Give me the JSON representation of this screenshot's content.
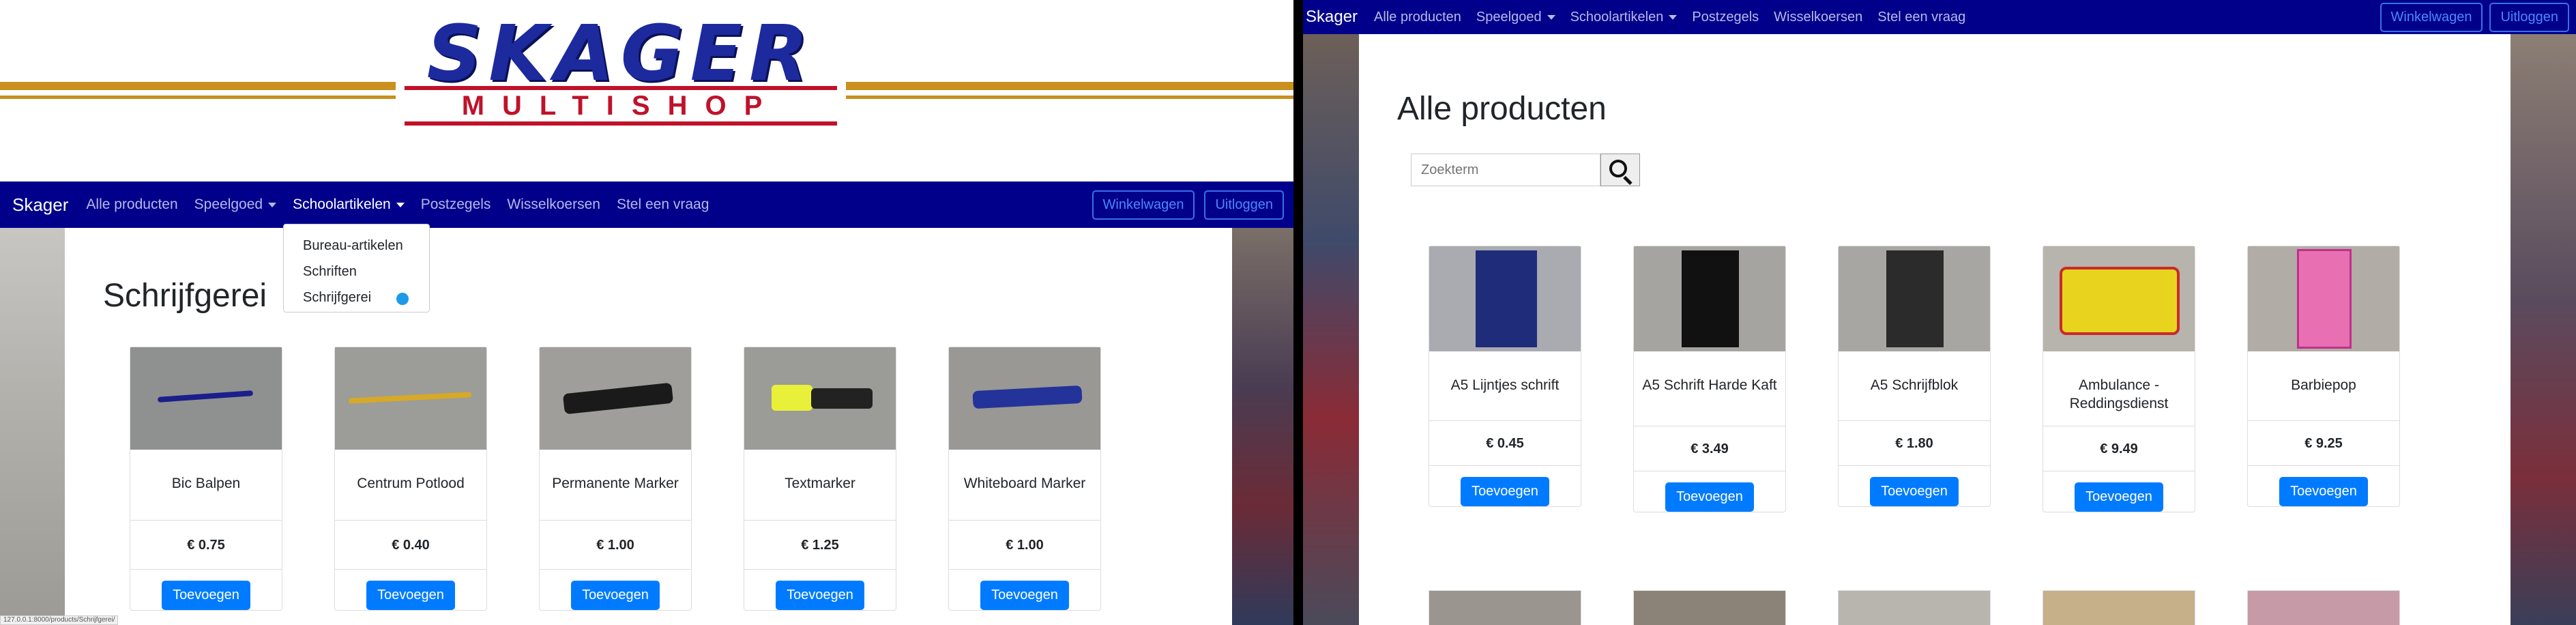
{
  "left": {
    "logo": {
      "word": "SKAGER",
      "sub": "MULTISHOP"
    },
    "navbar": {
      "brand": "Skager",
      "items": [
        {
          "label": "Alle producten"
        },
        {
          "label": "Speelgoed"
        },
        {
          "label": "Schoolartikelen"
        },
        {
          "label": "Postzegels"
        },
        {
          "label": "Wisselkoersen"
        },
        {
          "label": "Stel een vraag"
        }
      ],
      "cart_label": "Winkelwagen",
      "logout_label": "Uitloggen"
    },
    "dropdown": [
      "Bureau-artikelen",
      "Schriften",
      "Schrijfgerei"
    ],
    "page_title": "Schrijfgerei",
    "products": [
      {
        "name": "Bic Balpen",
        "price": "€ 0.75",
        "button": "Toevoegen"
      },
      {
        "name": "Centrum Potlood",
        "price": "€ 0.40",
        "button": "Toevoegen"
      },
      {
        "name": "Permanente Marker",
        "price": "€ 1.00",
        "button": "Toevoegen"
      },
      {
        "name": "Textmarker",
        "price": "€ 1.25",
        "button": "Toevoegen"
      },
      {
        "name": "Whiteboard Marker",
        "price": "€ 1.00",
        "button": "Toevoegen"
      }
    ],
    "status_url": "127.0.0.1:8000/products/Schrijfgerei/"
  },
  "right": {
    "navbar": {
      "brand": "Skager",
      "items": [
        {
          "label": "Alle producten"
        },
        {
          "label": "Speelgoed"
        },
        {
          "label": "Schoolartikelen"
        },
        {
          "label": "Postzegels"
        },
        {
          "label": "Wisselkoersen"
        },
        {
          "label": "Stel een vraag"
        }
      ],
      "cart_label": "Winkelwagen",
      "logout_label": "Uitloggen"
    },
    "page_title": "Alle producten",
    "search": {
      "placeholder": "Zoekterm"
    },
    "products": [
      {
        "name": "A5 Lijntjes schrift",
        "price": "€ 0.45",
        "button": "Toevoegen"
      },
      {
        "name": "A5 Schrift Harde Kaft",
        "price": "€ 3.49",
        "button": "Toevoegen"
      },
      {
        "name": "A5 Schrijfblok",
        "price": "€ 1.80",
        "button": "Toevoegen"
      },
      {
        "name": "Ambulance - Reddingsdienst",
        "price": "€ 9.49",
        "button": "Toevoegen"
      },
      {
        "name": "Barbiepop",
        "price": "€ 9.25",
        "button": "Toevoegen"
      }
    ]
  },
  "colors": {
    "navbar": "#00008b",
    "primary": "#007bff",
    "logo_blue": "#1d2a9e",
    "logo_red": "#c0122a",
    "stripe": "#c9901e"
  }
}
